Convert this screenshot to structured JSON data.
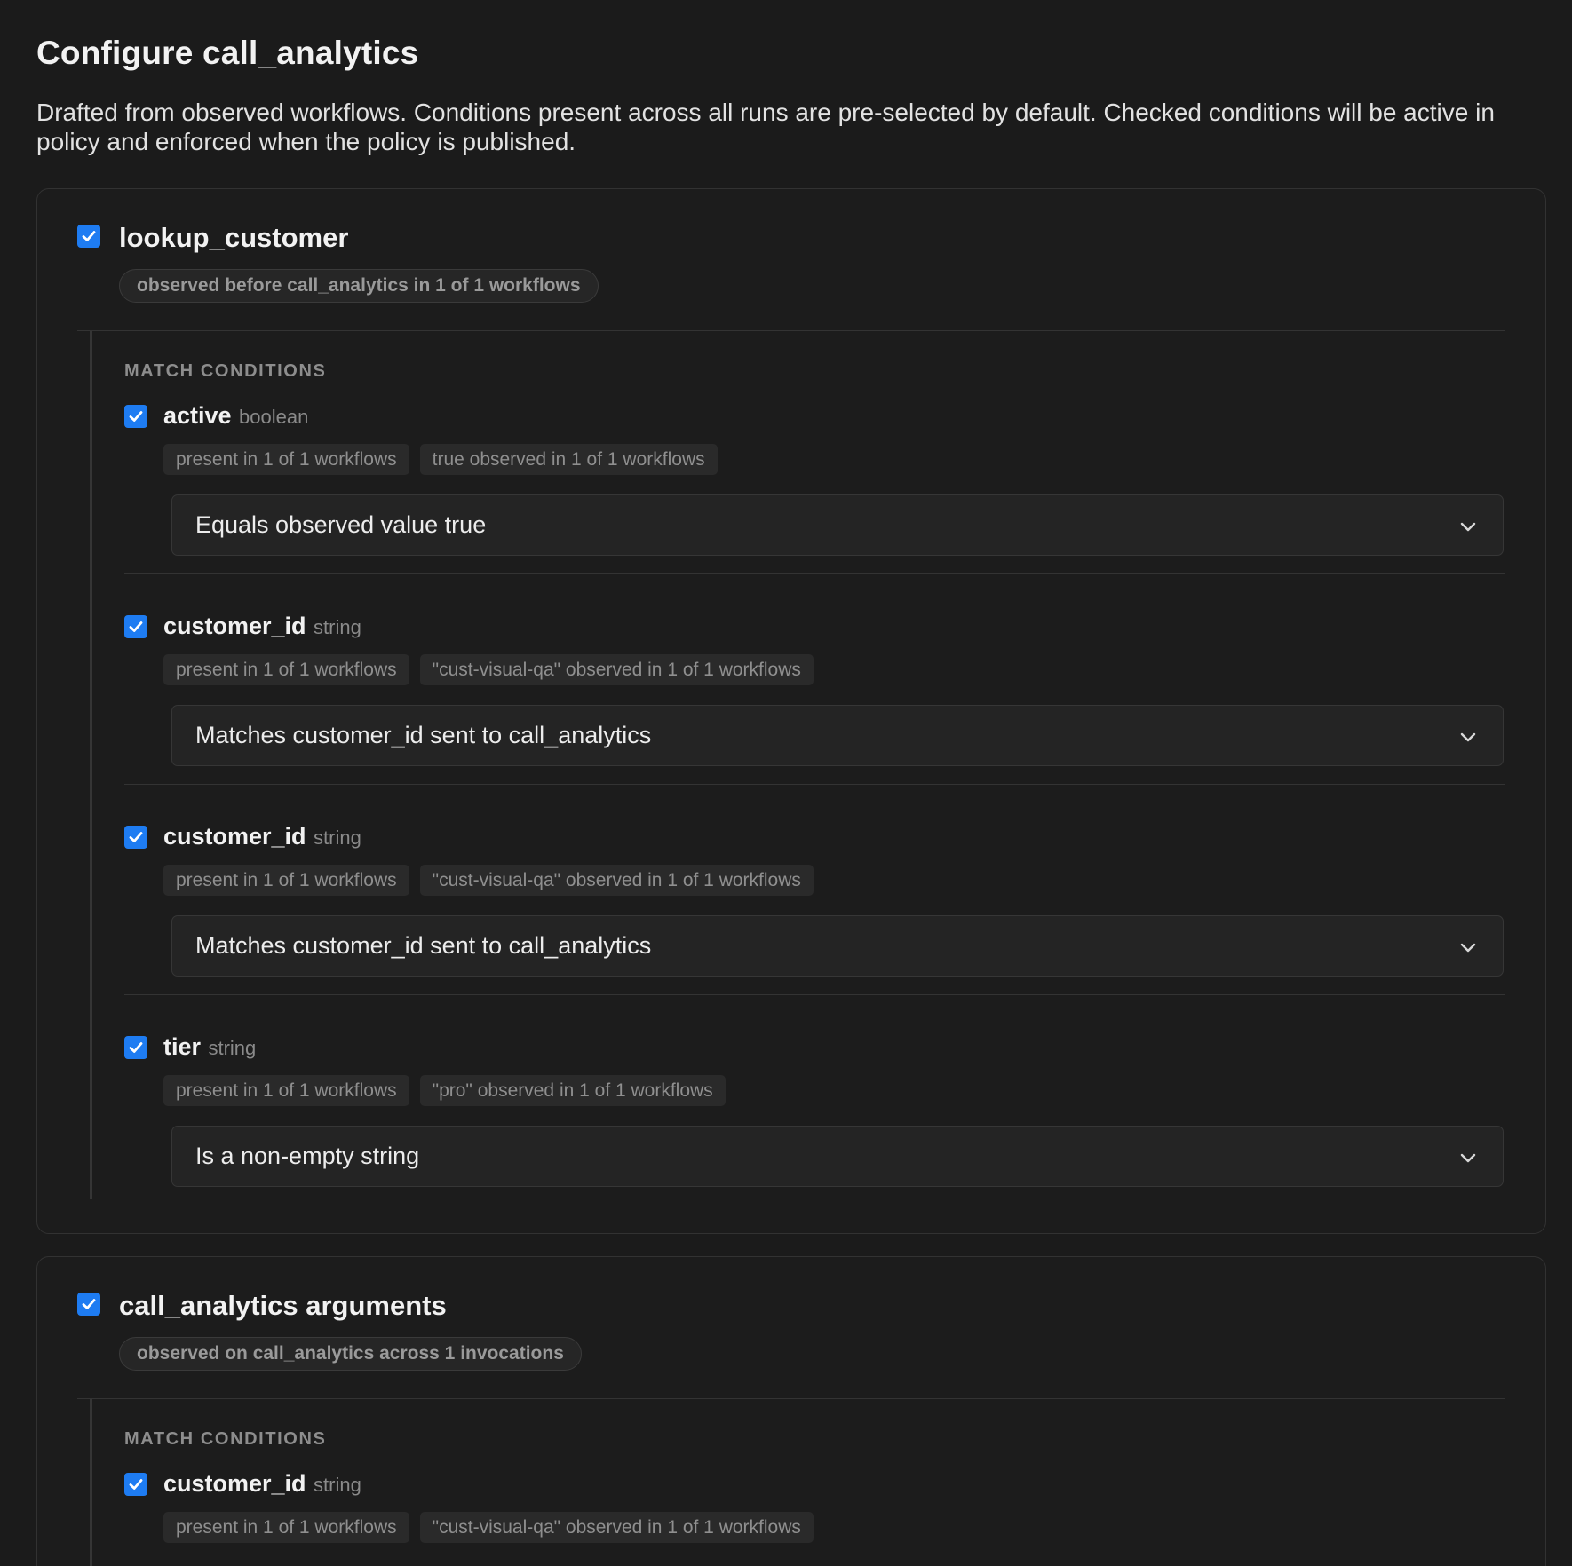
{
  "page": {
    "title": "Configure call_analytics",
    "description": "Drafted from observed workflows. Conditions present across all runs are pre-selected by default. Checked conditions will be active in policy and enforced when the policy is published."
  },
  "colors": {
    "background": "#1b1b1b",
    "checkbox": "#1e7cf2"
  },
  "cards": [
    {
      "title": "lookup_customer",
      "checked": true,
      "pill": "observed before call_analytics in 1 of 1 workflows",
      "section_label": "MATCH CONDITIONS",
      "conditions": [
        {
          "name": "active",
          "type": "boolean",
          "checked": true,
          "tags": [
            "present in 1 of 1 workflows",
            "true observed in 1 of 1 workflows"
          ],
          "select_value": "Equals observed value true"
        },
        {
          "name": "customer_id",
          "type": "string",
          "checked": true,
          "tags": [
            "present in 1 of 1 workflows",
            "\"cust-visual-qa\" observed in 1 of 1 workflows"
          ],
          "select_value": "Matches customer_id sent to call_analytics"
        },
        {
          "name": "customer_id",
          "type": "string",
          "checked": true,
          "tags": [
            "present in 1 of 1 workflows",
            "\"cust-visual-qa\" observed in 1 of 1 workflows"
          ],
          "select_value": "Matches customer_id sent to call_analytics"
        },
        {
          "name": "tier",
          "type": "string",
          "checked": true,
          "tags": [
            "present in 1 of 1 workflows",
            "\"pro\" observed in 1 of 1 workflows"
          ],
          "select_value": "Is a non-empty string"
        }
      ]
    },
    {
      "title": "call_analytics arguments",
      "checked": true,
      "pill": "observed on call_analytics across 1 invocations",
      "section_label": "MATCH CONDITIONS",
      "conditions": [
        {
          "name": "customer_id",
          "type": "string",
          "checked": true,
          "tags": [
            "present in 1 of 1 workflows",
            "\"cust-visual-qa\" observed in 1 of 1 workflows"
          ]
        }
      ]
    }
  ]
}
